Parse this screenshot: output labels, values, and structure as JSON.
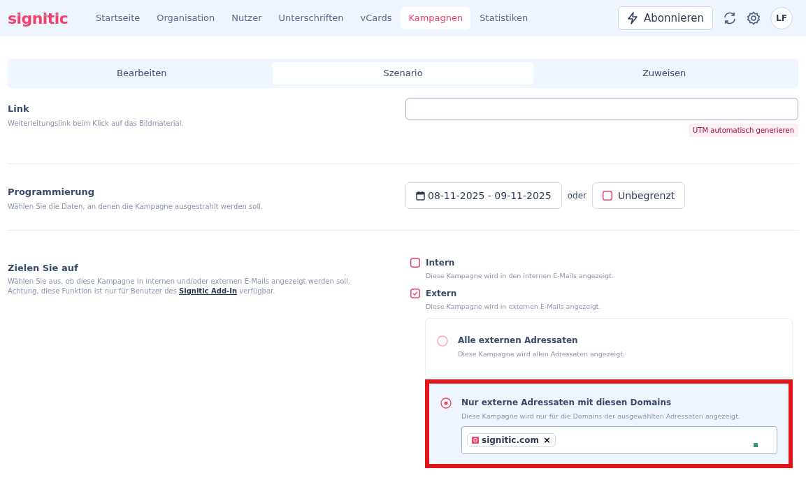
{
  "nav": {
    "logo": "signitic",
    "items": [
      {
        "label": "Startseite",
        "selected": false
      },
      {
        "label": "Organisation",
        "selected": false
      },
      {
        "label": "Nutzer",
        "selected": false
      },
      {
        "label": "Unterschriften",
        "selected": false
      },
      {
        "label": "vCards",
        "selected": false
      },
      {
        "label": "Kampagnen",
        "selected": true
      },
      {
        "label": "Statistiken",
        "selected": false
      }
    ],
    "subscribe_button": "Abonnieren",
    "avatar": "LF"
  },
  "tabs": [
    {
      "label": "Bearbeiten",
      "selected": false
    },
    {
      "label": "Szenario",
      "selected": true
    },
    {
      "label": "Zuweisen",
      "selected": false
    }
  ],
  "link_section": {
    "title": "Link",
    "description": "Weiterleitungslink beim Klick auf das Bildmaterial.",
    "utm_button": "UTM automatisch generieren"
  },
  "schedule_section": {
    "title": "Programmierung",
    "description": "Wählen Sie die Daten, an denen die Kampagne ausgestrahlt werden soll.",
    "date_range": "08-11-2025 - 09-11-2025",
    "or": "oder",
    "unlimited": {
      "label": "Unbegrenzt",
      "checked": false
    }
  },
  "target_section": {
    "title": "Zielen Sie auf",
    "description": "Wählen Sie aus, ob diese Kampagne in internen und/oder externen E-Mails angezeigt werden soll.",
    "note": "Achtung, diese Funktion ist nur für Benutzer des",
    "note_link": "Signitic Add-In",
    "note_end": "verfügbar.",
    "checkboxes": [
      {
        "label": "Intern",
        "description": "Diese Kampagne wird in den internen E-Mails angezeigt.",
        "checked": false
      },
      {
        "label": "Extern",
        "description": "Diese Kampagne wird in externen E-Mails angezeigt.",
        "checked": true
      }
    ],
    "options": [
      {
        "label": "Alle externen Adressaten",
        "description": "Diese Kampagne wird allen Adressaten angezeigt.",
        "selected": false,
        "highlighted": false
      },
      {
        "label": "Nur externe Adressaten mit diesen Domains",
        "description": "Diese Kampagne wird nur für die Domains der ausgewählten Adressaten angezeigt.",
        "selected": true,
        "highlighted": true,
        "domains": [
          "signitic.com"
        ],
        "remove": "×"
      }
    ]
  }
}
